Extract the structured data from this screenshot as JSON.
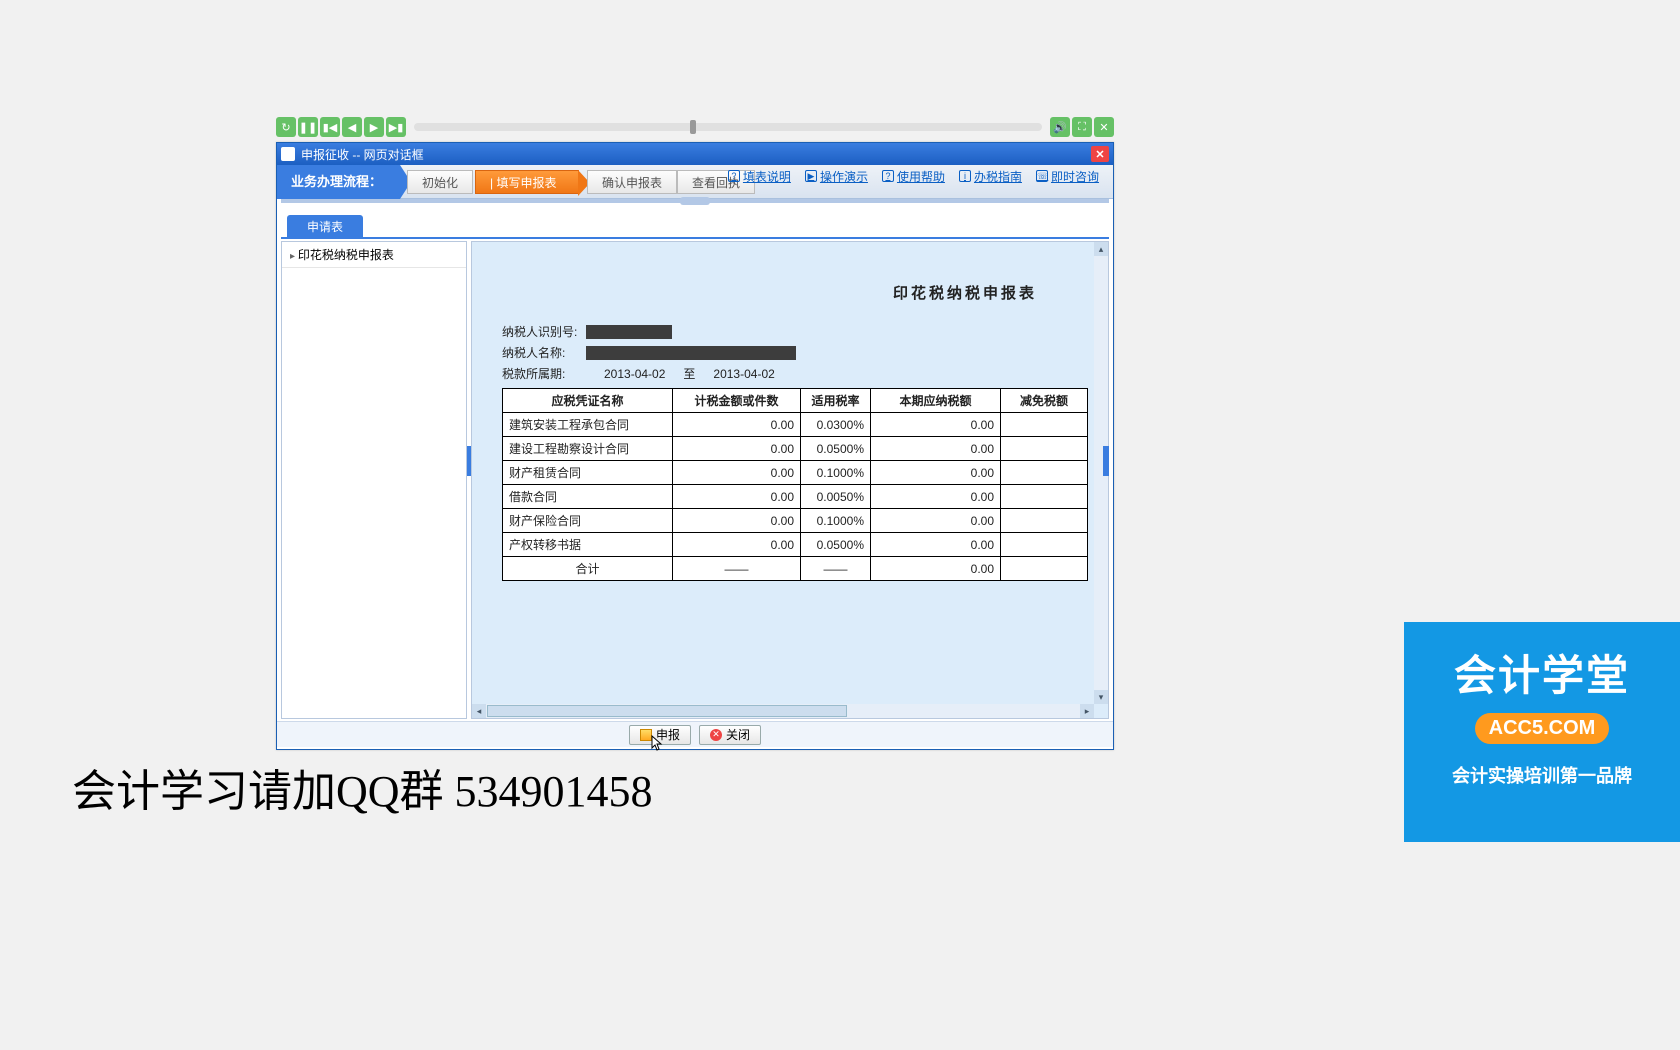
{
  "player": {
    "btns_left": [
      "↻",
      "❚❚",
      "▮◀",
      "◀",
      "▶",
      "▶▮"
    ],
    "btns_right": [
      "🔊",
      "⛶",
      "✕"
    ]
  },
  "window": {
    "title": "申报征收 -- 网页对话框"
  },
  "helpbar": {
    "items": [
      {
        "icon": "?",
        "label": "填表说明"
      },
      {
        "icon": "▶",
        "label": "操作演示"
      },
      {
        "icon": "?",
        "label": "使用帮助"
      },
      {
        "icon": "i",
        "label": "办税指南"
      },
      {
        "icon": "☏",
        "label": "即时咨询"
      }
    ]
  },
  "flow": {
    "label": "业务办理流程：",
    "steps": {
      "s1": "初始化",
      "s2": "| 填写申报表",
      "s3": "确认申报表",
      "s4": "查看回执"
    }
  },
  "tab": "申请表",
  "leftItem": "印花税纳税申报表",
  "form": {
    "title": "印花税纳税申报表",
    "id_label": "纳税人识别号:",
    "name_label": "纳税人名称:",
    "period_label": "税款所属期:",
    "period_from": "2013-04-02",
    "period_to_sep": "至",
    "period_to": "2013-04-02",
    "headers": {
      "c1": "应税凭证名称",
      "c2": "计税金额或件数",
      "c3": "适用税率",
      "c4": "本期应纳税额",
      "c5": "减免税额"
    },
    "rows": [
      {
        "name": "建筑安装工程承包合同",
        "amt": "0.00",
        "rate": "0.0300%",
        "tax": "0.00"
      },
      {
        "name": "建设工程勘察设计合同",
        "amt": "0.00",
        "rate": "0.0500%",
        "tax": "0.00"
      },
      {
        "name": "财产租赁合同",
        "amt": "0.00",
        "rate": "0.1000%",
        "tax": "0.00"
      },
      {
        "name": "借款合同",
        "amt": "0.00",
        "rate": "0.0050%",
        "tax": "0.00"
      },
      {
        "name": "财产保险合同",
        "amt": "0.00",
        "rate": "0.1000%",
        "tax": "0.00"
      },
      {
        "name": "产权转移书据",
        "amt": "0.00",
        "rate": "0.0500%",
        "tax": "0.00"
      }
    ],
    "total": {
      "label": "合计",
      "amt": "——",
      "rate": "——",
      "tax": "0.00"
    }
  },
  "buttons": {
    "submit": "申报",
    "close": "关闭"
  },
  "overlay": {
    "qq": "会计学习请加QQ群 534901458",
    "promo1": "会计学堂",
    "promo2": "ACC5.COM",
    "promo3": "会计实操培训第一品牌"
  }
}
